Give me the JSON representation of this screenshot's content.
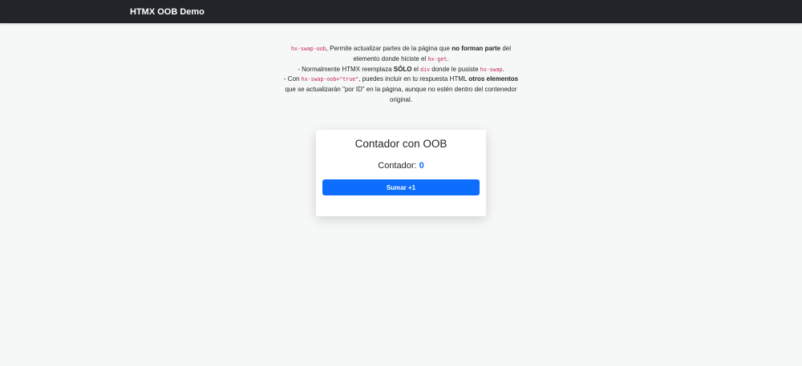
{
  "navbar": {
    "brand": "HTMX OOB Demo"
  },
  "description": {
    "l1_code": "hx-swap-oob",
    "l1_a": ", Permite actualizar partes de la página que ",
    "l1_bold": "no forman parte",
    "l1_b": " del",
    "l2_a": "elemento donde hiciste el ",
    "l2_code": "hx-get",
    "l2_b": ".",
    "l3_a": "- Normalmente HTMX reemplaza ",
    "l3_bold": "SÓLO",
    "l3_b": " el ",
    "l3_code1": "div",
    "l3_c": " donde le pusiste ",
    "l3_code2": "hx-swap",
    "l3_d": ".",
    "l4_a": "- Con ",
    "l4_code": "hx-swap-oob=\"true\"",
    "l4_b": ", puedes incluir en tu respuesta HTML ",
    "l4_bold": "otros elementos",
    "l5": "que se actualizarán \"por ID\" en la página, aunque no estén dentro del contenedor",
    "l6": "original."
  },
  "card": {
    "title": "Contador con OOB",
    "counter_label": "Contador: ",
    "counter_value": "0",
    "button_label": "Sumar +1"
  }
}
